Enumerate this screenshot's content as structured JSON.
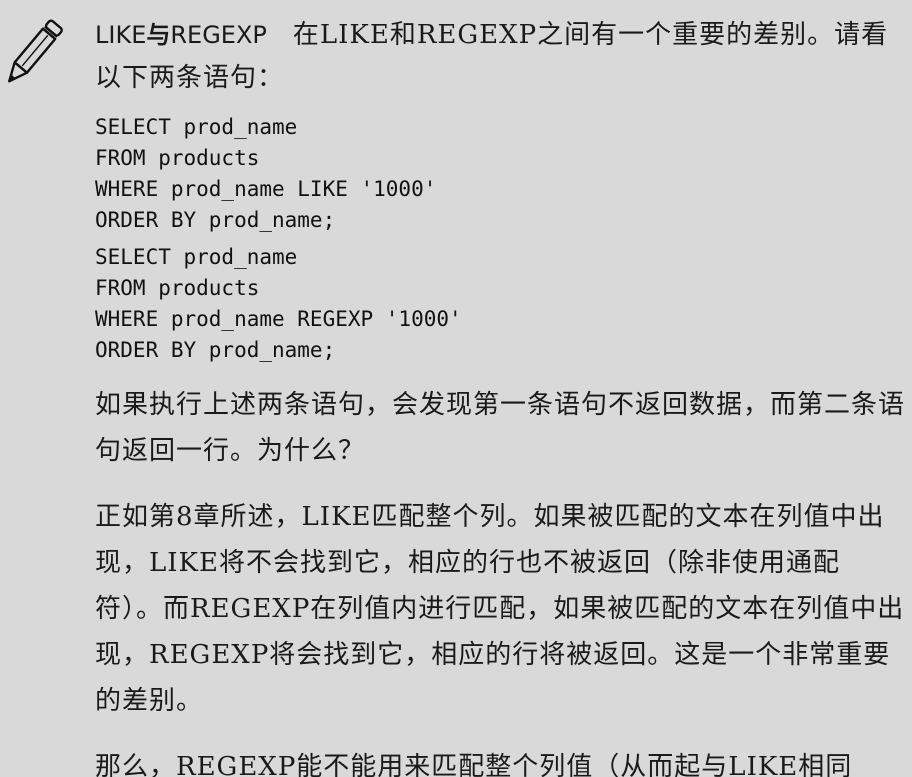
{
  "note": {
    "icon": "pencil-icon",
    "title_part1": "LIKE",
    "title_part2": "与",
    "title_part3": "REGEXP",
    "intro": "在LIKE和REGEXP之间有一个重要的差别。请看以下两条语句："
  },
  "code_blocks": [
    {
      "lines": [
        "SELECT prod_name",
        "FROM products",
        "WHERE prod_name LIKE '1000'",
        "ORDER BY prod_name;"
      ]
    },
    {
      "lines": [
        "SELECT prod_name",
        "FROM products",
        "WHERE prod_name REGEXP '1000'",
        "ORDER BY prod_name;"
      ]
    }
  ],
  "paragraphs": [
    "如果执行上述两条语句，会发现第一条语句不返回数据，而第二条语句返回一行。为什么？",
    "正如第8章所述，LIKE匹配整个列。如果被匹配的文本在列值中出现，LIKE将不会找到它，相应的行也不被返回（除非使用通配符）。而REGEXP在列值内进行匹配，如果被匹配的文本在列值中出现，REGEXP将会找到它，相应的行将被返回。这是一个非常重要的差别。",
    "那么，REGEXP能不能用来匹配整个列值（从而起与LIKE相同"
  ]
}
